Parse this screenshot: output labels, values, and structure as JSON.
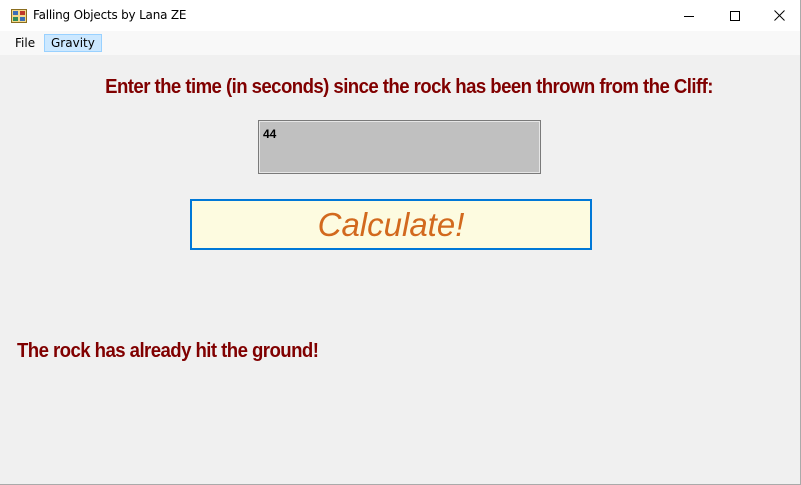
{
  "window": {
    "title": "Falling Objects by Lana ZE"
  },
  "menu": {
    "items": [
      "File",
      "Gravity"
    ]
  },
  "main": {
    "prompt": "Enter the time (in seconds) since the rock has been thrown from the Cliff:",
    "time_input_value": "44",
    "calculate_label": "Calculate!",
    "result": "The rock has already hit the ground!"
  },
  "colors": {
    "label_text": "#800000",
    "button_text": "#d2691e",
    "button_bg": "#fdfbe0",
    "button_border": "#0078d7",
    "input_bg": "#c0c0c0"
  },
  "icons": {
    "app": "app-icon",
    "minimize": "minimize-icon",
    "maximize": "maximize-icon",
    "close": "close-icon"
  }
}
